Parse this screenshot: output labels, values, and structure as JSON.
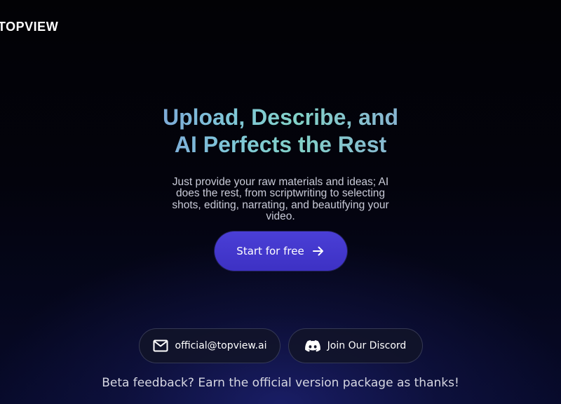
{
  "header": {
    "logo_text": "TOPVIEW"
  },
  "hero": {
    "title_line1": "Upload, Describe, and",
    "title_line2": "AI Perfects the Rest",
    "subtitle": "Just provide your raw materials and ideas; AI does the rest, from scriptwriting to selecting shots, editing, narrating, and beautifying your video.",
    "cta_label": "Start for free",
    "cta_icon": "arrow-right-icon"
  },
  "contact": {
    "email_label": "official@topview.ai",
    "email_icon": "mail-icon",
    "discord_label": "Join Our Discord",
    "discord_icon": "discord-icon"
  },
  "footer": {
    "note": "Beta feedback? Earn the official version package as thanks!"
  },
  "colors": {
    "background": "#03030c",
    "cta_background": "#4338ca",
    "title_gradient_start": "#7b93d8",
    "title_gradient_mid": "#82d1c7",
    "subtitle_text": "#c9cbd8"
  }
}
